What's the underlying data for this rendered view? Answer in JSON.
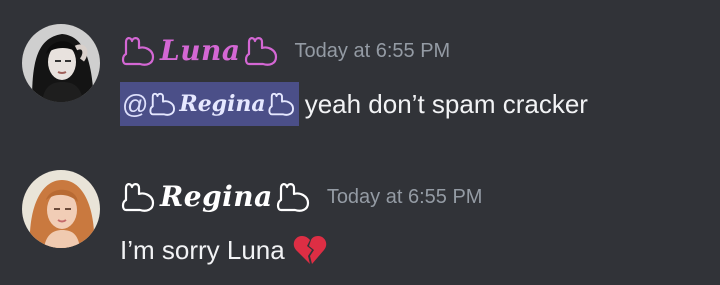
{
  "messages": [
    {
      "author": "Luna",
      "timestamp": "Today at 6:55 PM",
      "name_color": "#d467d4",
      "mention": {
        "prefix": "@",
        "name": "Regina"
      },
      "text": "yeah don’t spam cracker"
    },
    {
      "author": "Regina",
      "timestamp": "Today at 6:55 PM",
      "name_color": "#ffffff",
      "text": "I’m sorry Luna",
      "emoji": "broken-heart-icon"
    }
  ],
  "colors": {
    "background": "#313338",
    "timestamp": "#949ba4",
    "mention_bg": "#4b4f88",
    "text": "#f2f3f5"
  }
}
